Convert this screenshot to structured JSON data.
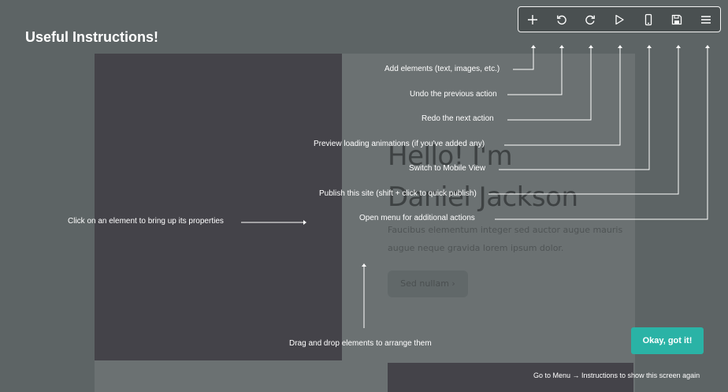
{
  "title": "Useful Instructions!",
  "site_preview": {
    "heading_line1": "Hello! I'm",
    "heading_line2": "Daniel Jackson",
    "body_line1": "Faucibus elementum integer sed auctor augue mauris",
    "body_line2": "augue neque gravida lorem ipsum dolor.",
    "button_label": "Sed nullam  ›"
  },
  "toolbar": {
    "items": [
      {
        "icon": "plus-icon"
      },
      {
        "icon": "undo-icon"
      },
      {
        "icon": "redo-icon"
      },
      {
        "icon": "play-icon"
      },
      {
        "icon": "mobile-icon"
      },
      {
        "icon": "save-icon"
      },
      {
        "icon": "menu-icon"
      }
    ]
  },
  "labels": {
    "add": "Add elements (text, images, etc.)",
    "undo": "Undo the previous action",
    "redo": "Redo the next action",
    "preview": "Preview loading animations (if you've added any)",
    "mobile": "Switch to Mobile View",
    "publish": "Publish this site (shift + click to quick publish)",
    "menu": "Open menu for additional actions",
    "properties": "Click on an element to bring up its properties",
    "drag": "Drag and drop elements to arrange them"
  },
  "ok_button": "Okay, got it!",
  "footer_note": "Go to Menu → Instructions to show this screen again",
  "colors": {
    "overlay": "#5d6465",
    "accent": "#2ab3a6",
    "text": "#ffffff"
  }
}
